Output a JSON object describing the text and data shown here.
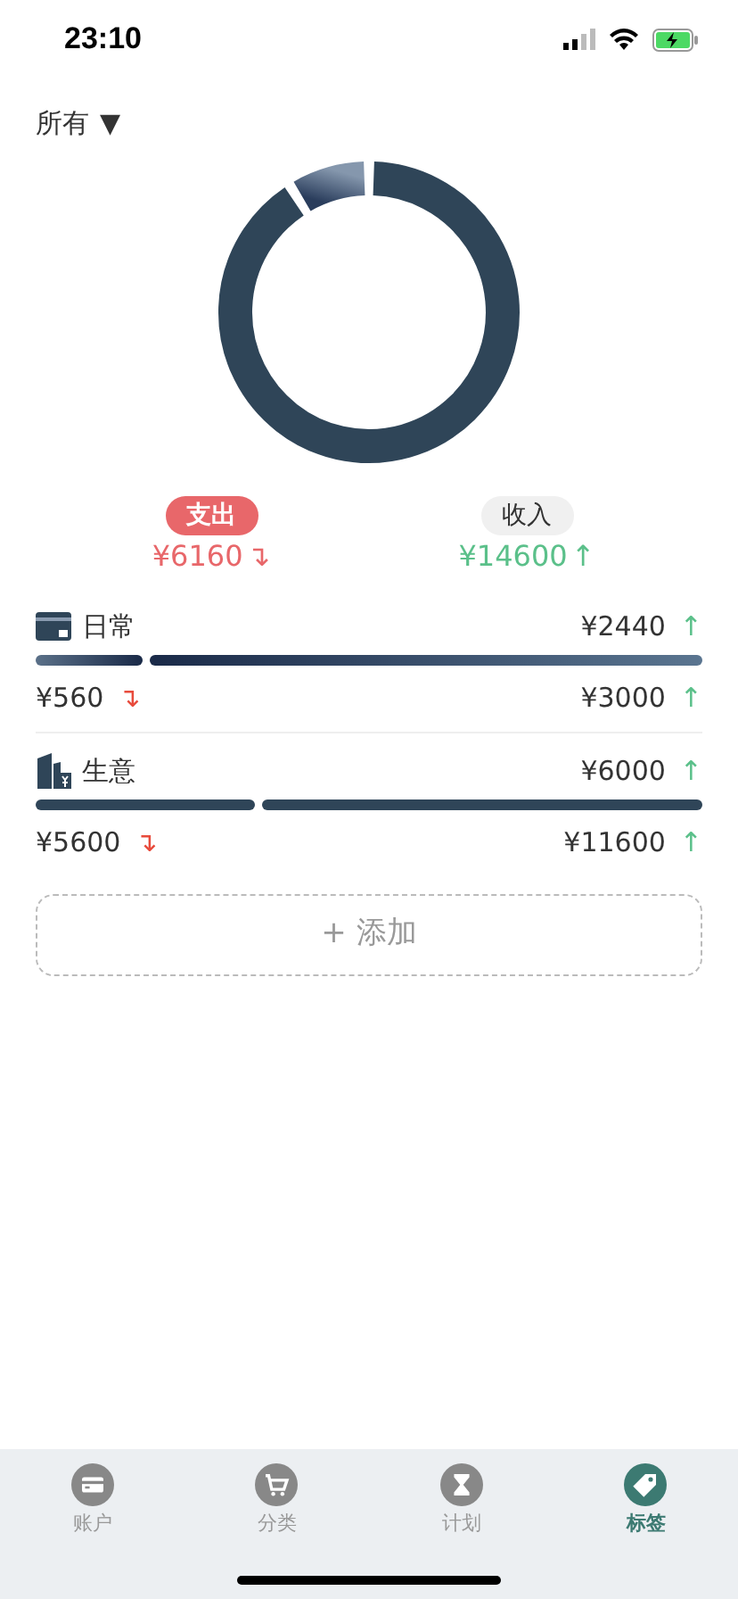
{
  "status_bar": {
    "time": "23:10"
  },
  "filter": {
    "label": "所有",
    "caret": "▼"
  },
  "totals": [
    {
      "label": "支出",
      "amount": "¥6160",
      "arrow": "↴",
      "kind": "expense",
      "selected": true
    },
    {
      "label": "收入",
      "amount": "¥14600",
      "arrow": "↑",
      "kind": "income",
      "selected": false
    }
  ],
  "tags": [
    {
      "name": "日常",
      "kind": "card",
      "balance": "¥2440",
      "balance_arrow": "↑",
      "expense": "¥560",
      "expense_arrow": "↴",
      "income": "¥3000",
      "income_arrow": "↑"
    },
    {
      "name": "生意",
      "kind": "business",
      "balance": "¥6000",
      "balance_arrow": "↑",
      "expense": "¥5600",
      "expense_arrow": "↴",
      "income": "¥11600",
      "income_arrow": "↑"
    }
  ],
  "add_button": {
    "plus": "+",
    "label": "添加"
  },
  "tab_bar": [
    {
      "label": "账户",
      "selected": false
    },
    {
      "label": "分类",
      "selected": false
    },
    {
      "label": "计划",
      "selected": false
    },
    {
      "label": "标签",
      "selected": true
    }
  ]
}
